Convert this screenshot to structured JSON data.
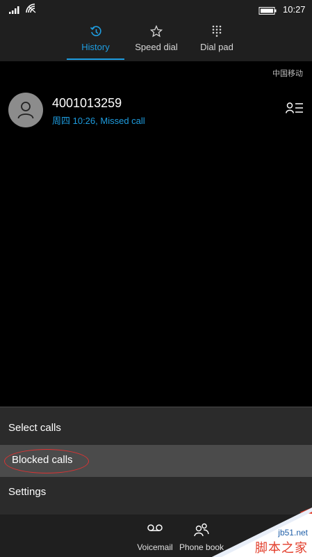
{
  "status_bar": {
    "time": "10:27",
    "icons": [
      "signal-icon",
      "wifi-icon",
      "battery-icon"
    ]
  },
  "pivot": {
    "tabs": [
      {
        "label": "History",
        "icon": "history-icon",
        "active": true
      },
      {
        "label": "Speed dial",
        "icon": "star-icon",
        "active": false
      },
      {
        "label": "Dial pad",
        "icon": "dialpad-icon",
        "active": false
      }
    ]
  },
  "carrier": "中国移动",
  "history": {
    "items": [
      {
        "number": "4001013259",
        "detail": "周四 10:26, Missed call"
      }
    ]
  },
  "menu": {
    "items": [
      {
        "label": "Select calls"
      },
      {
        "label": "Blocked calls",
        "highlighted": true
      },
      {
        "label": "Settings"
      }
    ]
  },
  "appbar": {
    "buttons": [
      {
        "label": "Voicemail",
        "icon": "voicemail-icon"
      },
      {
        "label": "Phone book",
        "icon": "contacts-icon"
      }
    ]
  },
  "watermark": {
    "site": "jb51.net",
    "name": "脚本之家"
  },
  "colors": {
    "accent": "#1e9de0",
    "annotation": "#dd3333",
    "watermark_red": "#e23d2a"
  }
}
